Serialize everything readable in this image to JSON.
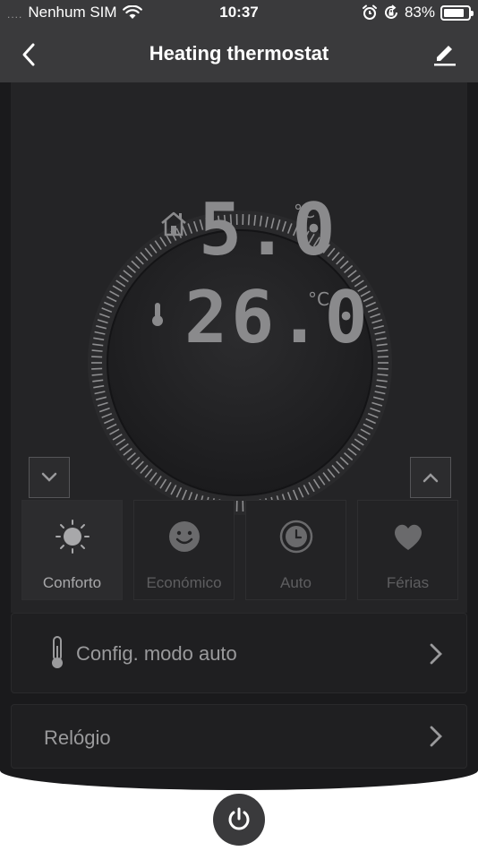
{
  "status_bar": {
    "signal": "....",
    "carrier": "Nenhum SIM",
    "time": "10:37",
    "battery_percent": "83%",
    "battery_level": 0.83,
    "icons": [
      "wifi-icon",
      "alarm-icon",
      "rotation-lock-icon",
      "battery-icon"
    ]
  },
  "nav": {
    "title": "Heating thermostat",
    "back_icon": "chevron-left-icon",
    "edit_icon": "pencil-icon"
  },
  "thermostat": {
    "set_temperature": "5.0",
    "current_temperature": "26.0",
    "unit": "°C",
    "set_icon": "home-icon",
    "current_icon": "thermometer-icon",
    "down_icon": "chevron-down-icon",
    "up_icon": "chevron-up-icon"
  },
  "modes": [
    {
      "label": "Conforto",
      "icon": "sun-icon",
      "active": true
    },
    {
      "label": "Económico",
      "icon": "smiley-icon",
      "active": false
    },
    {
      "label": "Auto",
      "icon": "clock-icon",
      "active": false
    },
    {
      "label": "Férias",
      "icon": "heart-icon",
      "active": false
    }
  ],
  "rows": {
    "auto_config": "Config. modo auto",
    "clock": "Relógio"
  },
  "colors": {
    "bar": "#3a3a3c",
    "background": "#1a1a1c",
    "panel": "#242426",
    "digits": "#8a8a8c"
  },
  "power_icon": "power-icon"
}
